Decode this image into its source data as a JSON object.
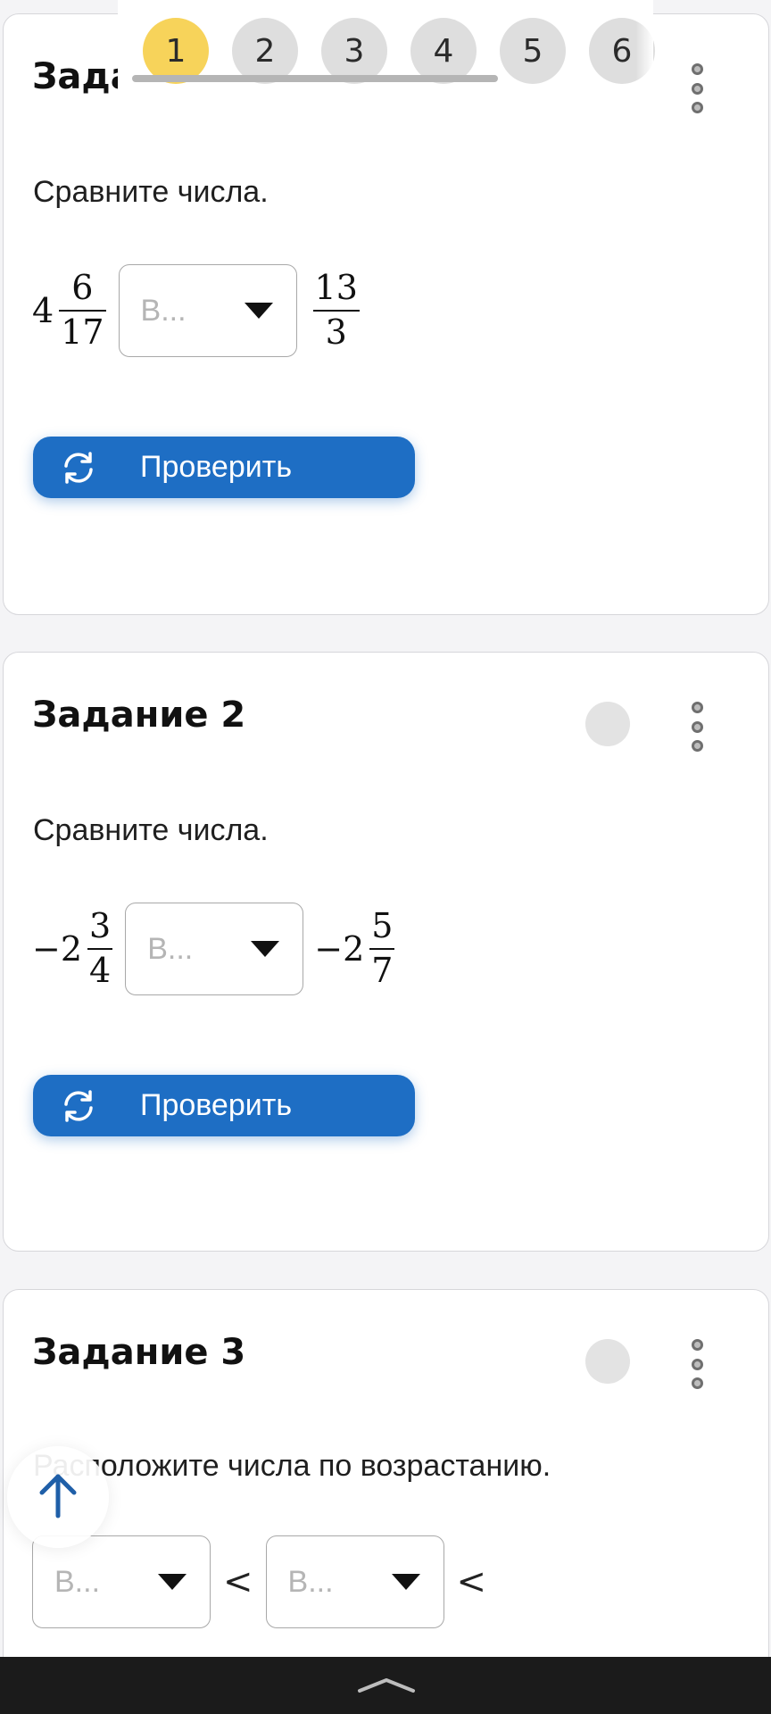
{
  "pager": {
    "items": [
      {
        "label": "1",
        "active": true
      },
      {
        "label": "2",
        "active": false
      },
      {
        "label": "3",
        "active": false
      },
      {
        "label": "4",
        "active": false
      },
      {
        "label": "5",
        "active": false
      },
      {
        "label": "6",
        "active": false
      }
    ]
  },
  "tasks": [
    {
      "title": "Задание 1",
      "prompt": "Сравните числа.",
      "left": {
        "sign": "",
        "whole": "4",
        "num": "6",
        "den": "17"
      },
      "select_placeholder": "В...",
      "right": {
        "sign": "",
        "whole": "",
        "num": "13",
        "den": "3"
      },
      "button_label": "Проверить"
    },
    {
      "title": "Задание 2",
      "prompt": "Сравните числа.",
      "left": {
        "sign": "−",
        "whole": "2",
        "num": "3",
        "den": "4"
      },
      "select_placeholder": "В...",
      "right": {
        "sign": "−",
        "whole": "2",
        "num": "5",
        "den": "7"
      },
      "button_label": "Проверить"
    },
    {
      "title": "Задание 3",
      "prompt": "Расположите числа по возрастанию.",
      "selects": [
        "В...",
        "В..."
      ],
      "operator": "<"
    }
  ],
  "icons": {
    "refresh": "refresh-icon",
    "more": "kebab-menu-icon",
    "up": "arrow-up-icon",
    "nav": "chevron-up-icon"
  },
  "colors": {
    "primary": "#1e6ec4",
    "active_page": "#f7d35a",
    "inactive_page": "#dedede",
    "nav_bar": "#1b1b1b"
  }
}
